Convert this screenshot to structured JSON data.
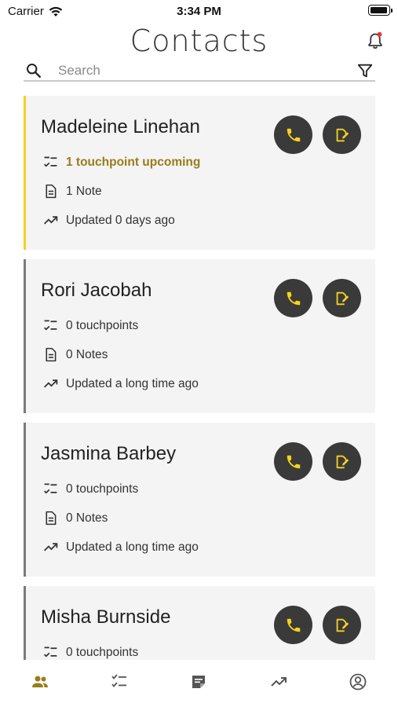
{
  "status_bar": {
    "carrier": "Carrier",
    "time": "3:34 PM"
  },
  "header": {
    "title": "Contacts",
    "notification_dot_color": "#e53935"
  },
  "search": {
    "placeholder": "Search",
    "value": ""
  },
  "colors": {
    "accent": "#f4d21f",
    "upcoming_text": "#9a7c19",
    "button_bg": "#3a3a3a",
    "card_bg": "#f4f4f4",
    "nav_active": "#9a7c19"
  },
  "contacts": [
    {
      "name": "Madeleine Linehan",
      "touchpoints": "1 touchpoint upcoming",
      "notes": "1 Note",
      "updated": "Updated 0 days ago"
    },
    {
      "name": "Rori Jacobah",
      "touchpoints": "0 touchpoints",
      "notes": "0 Notes",
      "updated": "Updated a long time ago"
    },
    {
      "name": "Jasmina Barbey",
      "touchpoints": "0 touchpoints",
      "notes": "0 Notes",
      "updated": "Updated a long time ago"
    },
    {
      "name": "Misha Burnside",
      "touchpoints": "0 touchpoints",
      "notes": "",
      "updated": ""
    }
  ],
  "bottom_nav": [
    {
      "icon": "contacts-icon",
      "active": true
    },
    {
      "icon": "checklist-icon",
      "active": false
    },
    {
      "icon": "notes-icon",
      "active": false
    },
    {
      "icon": "trending-icon",
      "active": false
    },
    {
      "icon": "account-icon",
      "active": false
    }
  ]
}
